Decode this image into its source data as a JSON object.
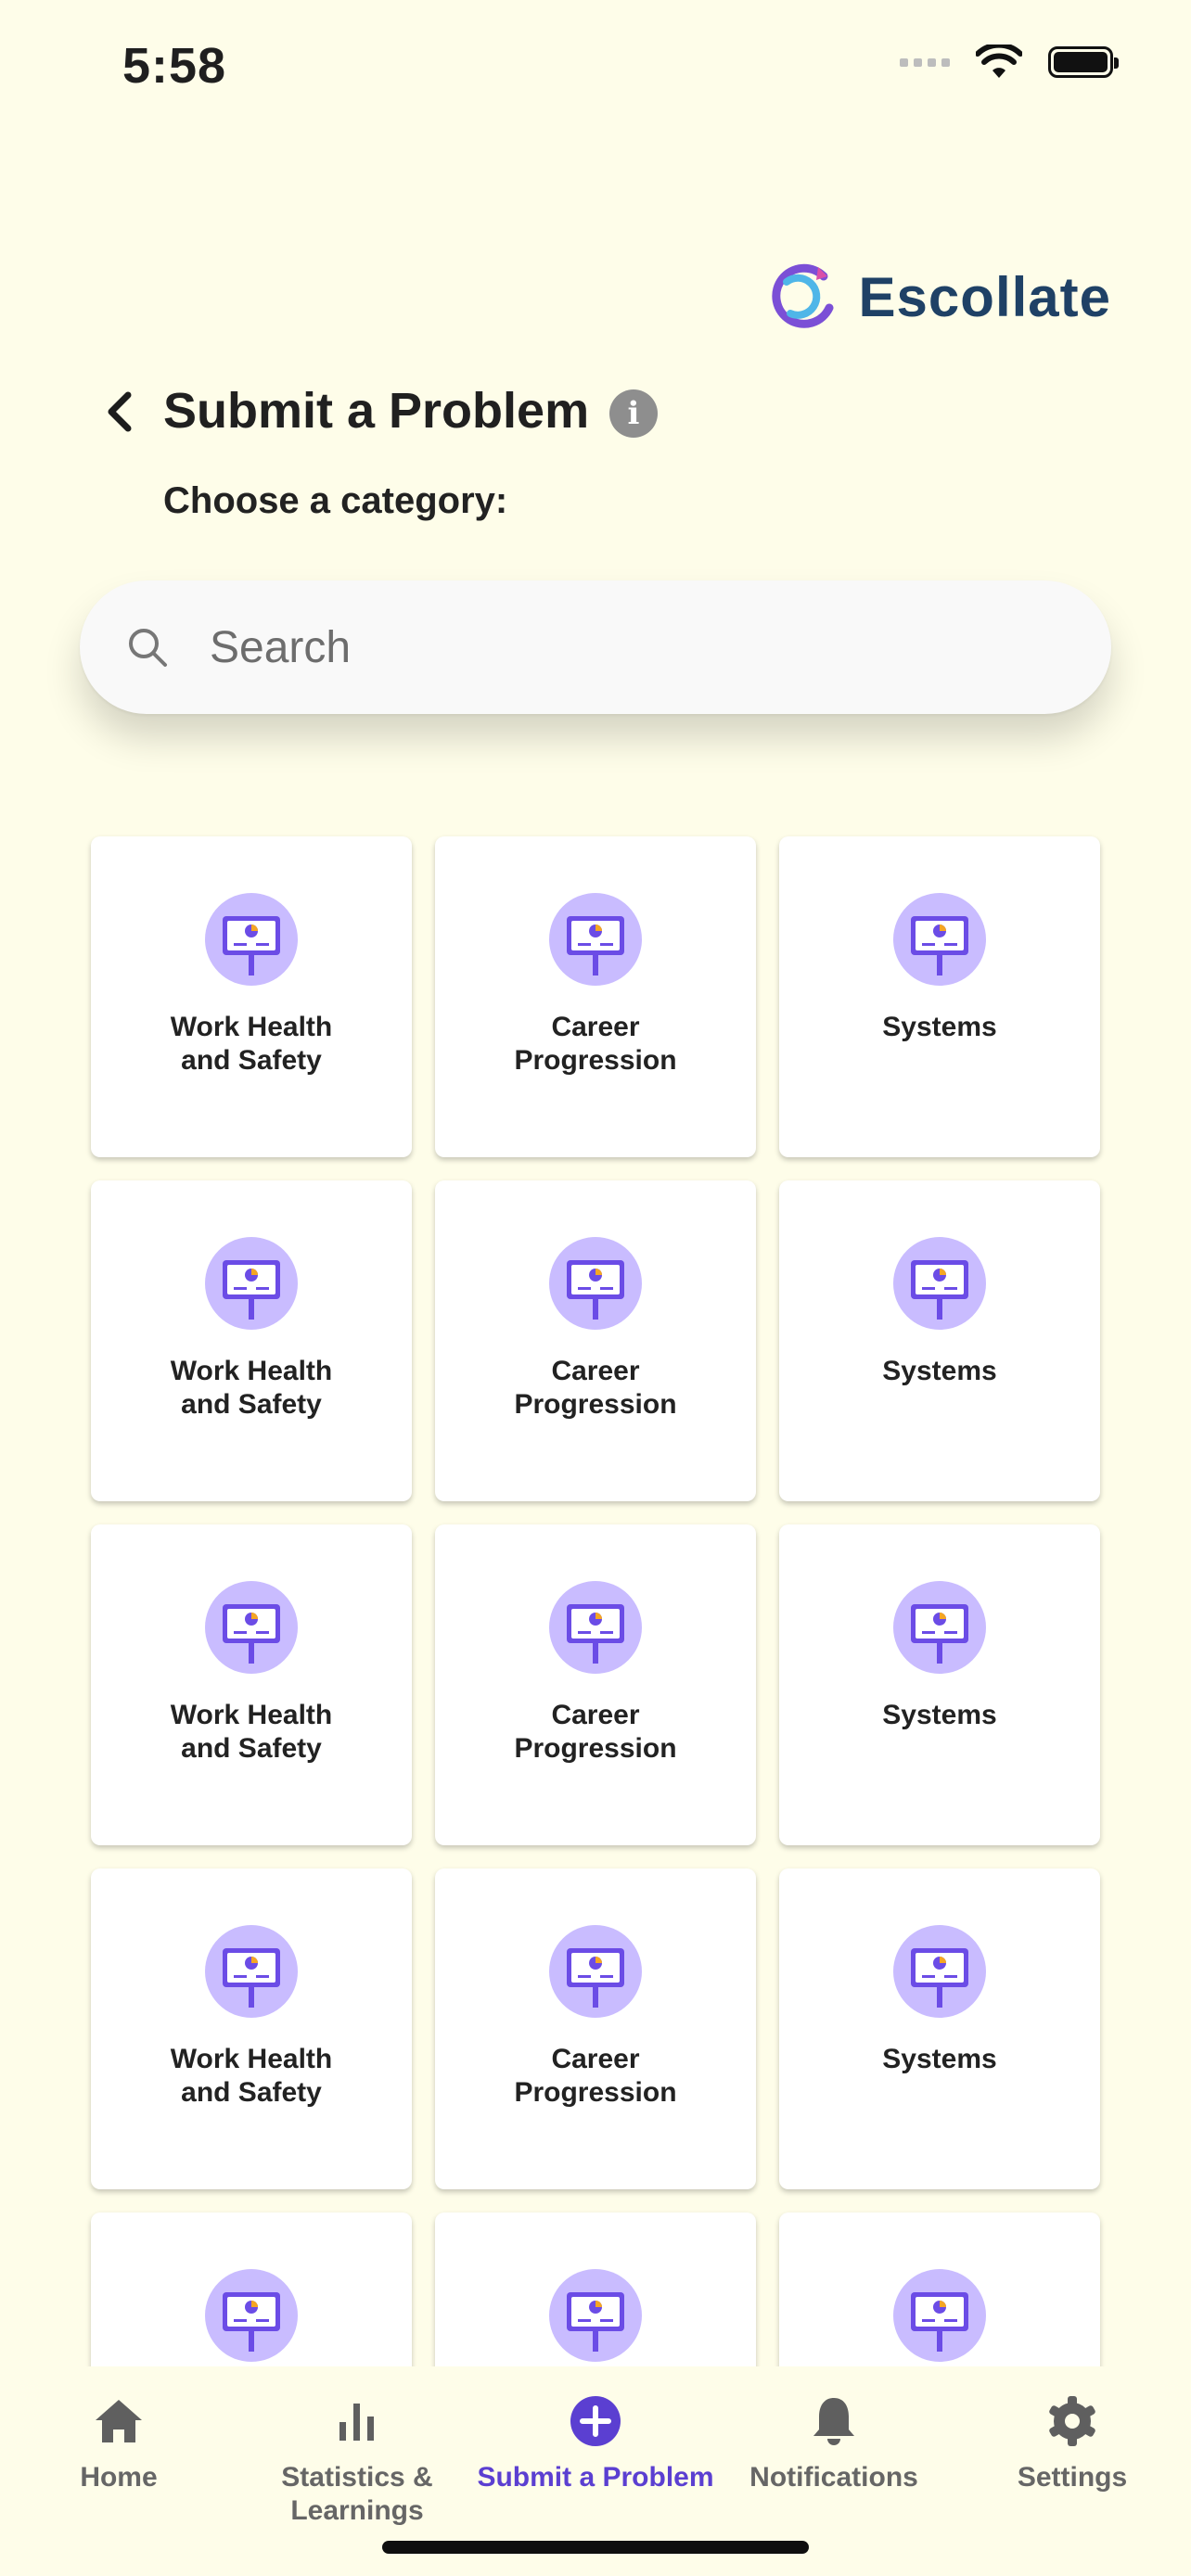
{
  "status_bar": {
    "time": "5:58"
  },
  "brand": {
    "name": "Escollate",
    "color": "#1f4166"
  },
  "header": {
    "title": "Submit a Problem",
    "subtitle": "Choose a category:",
    "info_icon": "info-icon",
    "back_icon": "chevron-left-icon"
  },
  "search": {
    "placeholder": "Search",
    "value": ""
  },
  "categories": [
    {
      "label": "Work Health and Safety"
    },
    {
      "label": "Career Progression"
    },
    {
      "label": "Systems"
    },
    {
      "label": "Work Health and Safety"
    },
    {
      "label": "Career Progression"
    },
    {
      "label": "Systems"
    },
    {
      "label": "Work Health and Safety"
    },
    {
      "label": "Career Progression"
    },
    {
      "label": "Systems"
    },
    {
      "label": "Work Health and Safety"
    },
    {
      "label": "Career Progression"
    },
    {
      "label": "Systems"
    },
    {
      "label": ""
    },
    {
      "label": ""
    },
    {
      "label": ""
    }
  ],
  "nav": {
    "items": [
      {
        "label": "Home",
        "icon": "home-icon"
      },
      {
        "label": "Statistics & Learnings",
        "icon": "bar-chart-icon"
      },
      {
        "label": "Submit a Problem",
        "icon": "plus-circle-icon",
        "active": true
      },
      {
        "label": "Notifications",
        "icon": "bell-icon"
      },
      {
        "label": "Settings",
        "icon": "gear-icon"
      }
    ]
  },
  "colors": {
    "background": "#FEFDE9",
    "accent": "#5b3fd1",
    "icon_bg": "#c8b9ff",
    "icon_pie": "#f5a623"
  }
}
